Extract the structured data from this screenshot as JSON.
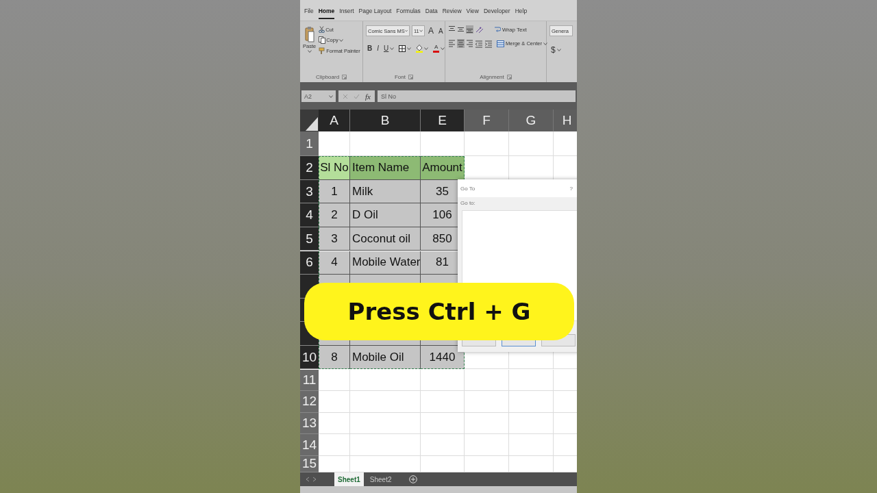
{
  "ribbon": {
    "tabs": [
      {
        "label": "File",
        "selected": false
      },
      {
        "label": "Home",
        "selected": true
      },
      {
        "label": "Insert",
        "selected": false
      },
      {
        "label": "Page Layout",
        "selected": false
      },
      {
        "label": "Formulas",
        "selected": false
      },
      {
        "label": "Data",
        "selected": false
      },
      {
        "label": "Review",
        "selected": false
      },
      {
        "label": "View",
        "selected": false
      },
      {
        "label": "Developer",
        "selected": false
      },
      {
        "label": "Help",
        "selected": false
      }
    ],
    "clipboard": {
      "paste": "Paste",
      "cut": "Cut",
      "copy": "Copy",
      "format_painter": "Format Painter",
      "group": "Clipboard"
    },
    "font": {
      "name": "Comic Sans MS",
      "size": "11",
      "grow": "A",
      "shrink": "A",
      "bold": "B",
      "italic": "I",
      "underline": "U",
      "text_color": "A",
      "group": "Font"
    },
    "alignment": {
      "vertical_align": [
        {
          "selected": false
        },
        {
          "selected": false
        },
        {
          "selected": true
        }
      ],
      "horizontal_align": [
        {
          "selected": false
        },
        {
          "selected": true
        },
        {
          "selected": false
        }
      ],
      "wrap": "Wrap Text",
      "merge": "Merge & Center",
      "group": "Alignment"
    },
    "number": {
      "format": "Genera",
      "currency": "$"
    }
  },
  "formula_bar": {
    "name_box": "A2",
    "fx": "fx",
    "value": "Sl No"
  },
  "grid": {
    "columns": [
      {
        "label": "A",
        "selected": true
      },
      {
        "label": "B",
        "selected": true
      },
      {
        "label": "E",
        "selected": true
      },
      {
        "label": "F",
        "selected": false
      },
      {
        "label": "G",
        "selected": false
      },
      {
        "label": "H",
        "selected": false
      }
    ],
    "rows": [
      {
        "number": "1",
        "selected": false
      },
      {
        "number": "2",
        "selected": true,
        "kind": "header",
        "cells": [
          {
            "text": "Sl No",
            "active": true
          },
          {
            "text": "Item Name",
            "active": false
          },
          {
            "text": "Amount",
            "active": false
          }
        ]
      },
      {
        "number": "3",
        "selected": true,
        "kind": "data",
        "cells": [
          {
            "text": "1",
            "active": false
          },
          {
            "text": "Milk",
            "active": false
          },
          {
            "text": "35",
            "active": false
          }
        ]
      },
      {
        "number": "4",
        "selected": true,
        "kind": "data",
        "cells": [
          {
            "text": "2",
            "active": false
          },
          {
            "text": "D Oil",
            "active": false
          },
          {
            "text": "106",
            "active": false
          }
        ]
      },
      {
        "number": "5",
        "selected": true,
        "kind": "data",
        "cells": [
          {
            "text": "3",
            "active": false
          },
          {
            "text": "Coconut oil",
            "active": false
          },
          {
            "text": "850",
            "active": false
          }
        ]
      },
      {
        "number": "6",
        "selected": true,
        "kind": "data",
        "cells": [
          {
            "text": "4",
            "active": false
          },
          {
            "text": "Mobile Water",
            "active": false
          },
          {
            "text": "81",
            "active": false
          }
        ]
      },
      {
        "selected": true
      },
      {
        "selected": true
      },
      {
        "selected": true
      },
      {
        "number": "10",
        "selected": true,
        "kind": "data",
        "cells": [
          {
            "text": "8",
            "active": false
          },
          {
            "text": "Mobile Oil",
            "active": false
          },
          {
            "text": "1440",
            "active": false
          }
        ]
      },
      {
        "number": "11",
        "selected": false
      },
      {
        "number": "12",
        "selected": false
      },
      {
        "number": "13",
        "selected": false
      },
      {
        "number": "14",
        "selected": false
      },
      {
        "number": "15",
        "selected": false
      }
    ]
  },
  "dialog": {
    "title": "Go To",
    "help": "?",
    "label": "Go to:"
  },
  "sheet_tabs": [
    {
      "label": "Sheet1",
      "selected": true
    },
    {
      "label": "Sheet2",
      "selected": false
    }
  ],
  "caption": "Press Ctrl + G"
}
